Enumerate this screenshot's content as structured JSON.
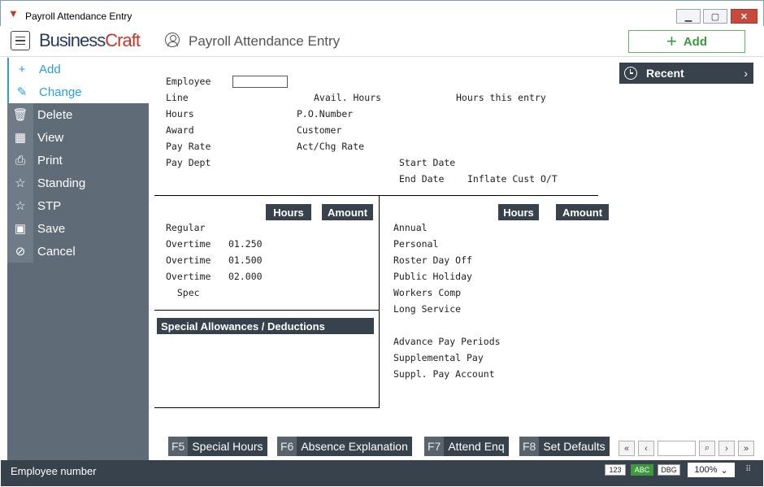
{
  "window": {
    "title": "Payroll Attendance Entry"
  },
  "header": {
    "logo_business": "Business",
    "logo_craft": "Craft",
    "page_title": "Payroll Attendance Entry",
    "add_label": "Add"
  },
  "sidebar": {
    "items": [
      {
        "label": "Add",
        "icon": "plus-icon",
        "glyph": "+"
      },
      {
        "label": "Change",
        "icon": "edit-icon",
        "glyph": "✎"
      },
      {
        "label": "Delete",
        "icon": "trash-icon",
        "glyph": "🗑"
      },
      {
        "label": "View",
        "icon": "table-icon",
        "glyph": "▦"
      },
      {
        "label": "Print",
        "icon": "printer-icon",
        "glyph": "⎙"
      },
      {
        "label": "Standing",
        "icon": "star-icon",
        "glyph": "☆"
      },
      {
        "label": "STP",
        "icon": "star-icon",
        "glyph": "☆"
      },
      {
        "label": "Save",
        "icon": "save-icon",
        "glyph": "▣"
      },
      {
        "label": "Cancel",
        "icon": "cancel-icon",
        "glyph": "⊘"
      }
    ]
  },
  "form": {
    "employee": "Employee",
    "line": "Line",
    "hours": "Hours",
    "award": "Award",
    "pay_rate": "Pay Rate",
    "pay_dept": "Pay Dept",
    "avail_hours": "Avail. Hours",
    "po_number": "P.O.Number",
    "customer": "Customer",
    "act_chg_rate": "Act/Chg Rate",
    "hours_this_entry": "Hours this entry",
    "start_date": "Start Date",
    "end_date": "End Date",
    "inflate_cust": "Inflate Cust O/T"
  },
  "left_grid": {
    "hours_hdr": "Hours",
    "amount_hdr": "Amount",
    "rows": [
      {
        "label": "Regular",
        "rate": ""
      },
      {
        "label": "Overtime",
        "rate": "01.250"
      },
      {
        "label": "Overtime",
        "rate": "01.500"
      },
      {
        "label": "Overtime",
        "rate": "02.000"
      },
      {
        "label": "  Spec",
        "rate": ""
      }
    ],
    "allowances_hdr": "Special Allowances / Deductions"
  },
  "right_grid": {
    "hours_hdr": "Hours",
    "amount_hdr": "Amount",
    "rows": [
      "Annual",
      "Personal",
      "Roster Day Off",
      "Public Holiday",
      "Workers Comp",
      "Long Service"
    ],
    "rows2": [
      "Advance Pay Periods",
      "Supplemental Pay",
      "Suppl. Pay Account"
    ]
  },
  "recent": {
    "label": "Recent"
  },
  "fkeys": [
    {
      "key": "F5",
      "label": "Special Hours"
    },
    {
      "key": "F6",
      "label": "Absence Explanation"
    },
    {
      "key": "F7",
      "label": "Attend Enq"
    },
    {
      "key": "F8",
      "label": "Set Defaults"
    }
  ],
  "status": {
    "message": "Employee number",
    "badge_num": "123",
    "badge_abc": "ABC",
    "badge_dbg": "DBG",
    "zoom": "100%"
  },
  "colors": {
    "accent": "#2b9fdb",
    "dark": "#38424c",
    "sidebar": "#5f6b77",
    "add_green": "#5cb85c",
    "brand_red": "#c0392b"
  }
}
